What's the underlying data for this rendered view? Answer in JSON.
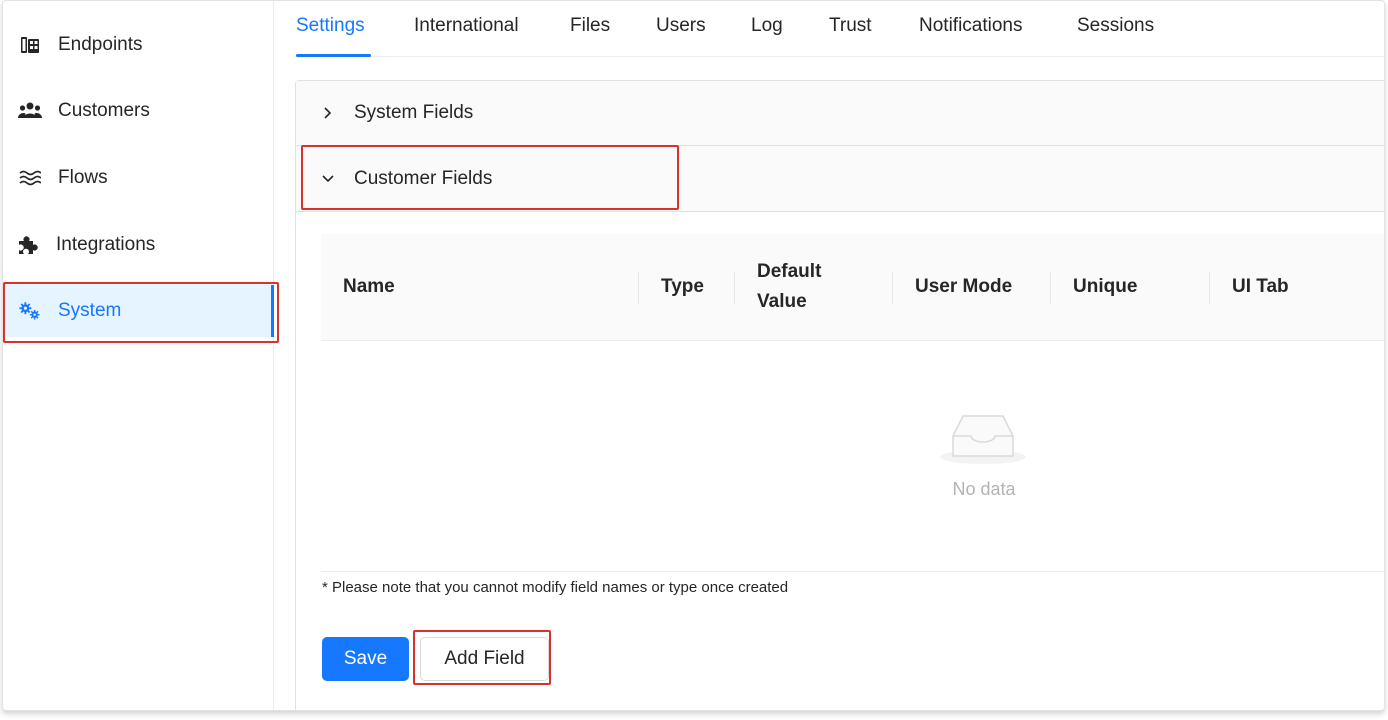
{
  "sidebar": {
    "items": [
      {
        "label": "Endpoints",
        "icon": "building-icon"
      },
      {
        "label": "Customers",
        "icon": "users-icon"
      },
      {
        "label": "Flows",
        "icon": "waves-icon"
      },
      {
        "label": "Integrations",
        "icon": "puzzle-icon"
      },
      {
        "label": "System",
        "icon": "gears-icon",
        "active": true
      }
    ]
  },
  "tabs": [
    "Settings",
    "International",
    "Files",
    "Users",
    "Log",
    "Trust",
    "Notifications",
    "Sessions"
  ],
  "active_tab": "Settings",
  "panels": [
    {
      "title": "System Fields",
      "expanded": false
    },
    {
      "title": "Customer Fields",
      "expanded": true
    }
  ],
  "table": {
    "columns": [
      "Name",
      "Type",
      "Default Value",
      "User Mode",
      "Unique",
      "UI Tab"
    ],
    "column_default_line1": "Default",
    "column_default_line2": "Value",
    "rows": [],
    "empty_text": "No data"
  },
  "note": "* Please note that you cannot modify field names or type once created",
  "buttons": {
    "save": "Save",
    "add_field": "Add Field"
  },
  "colors": {
    "accent": "#1677ff",
    "highlight": "#d9322c",
    "active_bg": "#e6f4ff"
  }
}
